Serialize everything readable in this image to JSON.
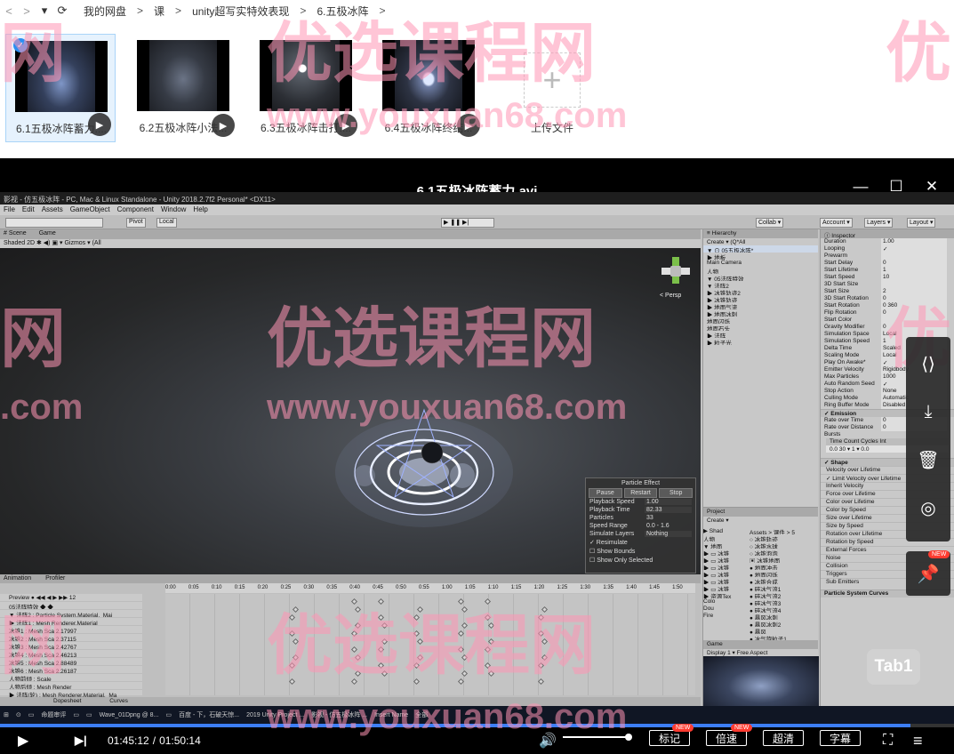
{
  "nav": {
    "back": "<",
    "forward": ">",
    "menu": "▾",
    "refresh": "⟳",
    "breadcrumbs": [
      "我的网盘",
      "课",
      "unity超写实特效表现",
      "6.五极冰阵"
    ],
    "sep": ">"
  },
  "files": [
    {
      "name": "6.1五极冰阵蓄力....",
      "selected": true
    },
    {
      "name": "6.2五极冰阵小法...",
      "selected": false
    },
    {
      "name": "6.3五极冰阵击打....",
      "selected": false
    },
    {
      "name": "6.4五极冰阵终结...",
      "selected": false
    }
  ],
  "upload_label": "上传文件",
  "check": "✓",
  "play_glyph": "▶",
  "player": {
    "title": "6.1五极冰阵蓄力.avi",
    "minimize": "—",
    "maximize": "☐",
    "close": "✕"
  },
  "unity": {
    "title": "影视 - 仿五极冰阵 - PC, Mac & Linux Standalone - Unity 2018.2.7f2 Personal* <DX11>",
    "menu": [
      "File",
      "Edit",
      "Assets",
      "GameObject",
      "Component",
      "Window",
      "Help"
    ],
    "toolbar": {
      "pivot": "Pivot",
      "local": "Local",
      "collab": "Collab ▾",
      "account": "Account ▾",
      "layers": "Layers ▾",
      "layout": "Layout ▾"
    },
    "scene_tabs": [
      "# Scene",
      "Game"
    ],
    "scene_ctrl": "Shaded     2D   ✱  ◀)  ▣  ▾     Gizmos ▾   (All",
    "persp": "< Persp",
    "particle_effect": {
      "header": "Particle Effect",
      "buttons": [
        "Pause",
        "Restart",
        "Stop"
      ],
      "rows": [
        {
          "k": "Playback Speed",
          "v": "1.00"
        },
        {
          "k": "Playback Time",
          "v": "82.33"
        },
        {
          "k": "Particles",
          "v": "33"
        },
        {
          "k": "Speed Range",
          "v": "0.0 - 1.6"
        },
        {
          "k": "Simulate Layers",
          "v": "Nothing"
        },
        {
          "k": "✓ Resimulate",
          "v": ""
        },
        {
          "k": "☐ Show Bounds",
          "v": ""
        },
        {
          "k": "☐ Show Only Selected",
          "v": ""
        }
      ]
    },
    "animation": {
      "tabs": [
        "Animation",
        "Profiler"
      ],
      "ruler": [
        "0:00",
        "0:05",
        "0:10",
        "0:15",
        "0:20",
        "0:25",
        "0:30",
        "0:35",
        "0:40",
        "0:45",
        "0:50",
        "0:55",
        "1:00",
        "1:05",
        "1:10",
        "1:15",
        "1:20",
        "1:25",
        "1:30",
        "1:35",
        "1:40",
        "1:45",
        "1:50"
      ],
      "props": [
        "Preview  ● ◀◀ ◀ ▶ ▶▶  12",
        "05法阵特效  ◆ ◆",
        "▼ 法阵2 : Particle System.Material._Mai",
        "  ▶ 法阵1 : Mesh Renderer.Material",
        "    冰锥1 : Mesh Sca 2.17997",
        "    冰锥2 : Mesh Sca 2.37115",
        "    冰锥3 : Mesh Sca 2.42767",
        "    冰锥4 : Mesh Sca 2.46213",
        "    冰锥5 : Mesh Sca 2.88489",
        "    冰锥6 : Mesh Sca 2.26187",
        "  人物前倾 : Scale",
        "  人物后倾 : Mesh Render",
        "  ▶ 法阵(轮) : Mesh Renderer.Material._Ma"
      ],
      "bottom": [
        "Dopesheet",
        "Curves"
      ]
    },
    "hierarchy": {
      "title": "≡ Hierarchy",
      "rows": [
        "Create ▾  (Q*All",
        "▼ ⊙ 05五极冰阵*",
        "    ▶ 地板",
        "       Main Camera",
        "       人物",
        "    ▼ 05法阵特效",
        "       ▼ 法阵2",
        "          ▶ 冰锥轨迹2",
        "          ▶ 冰锥轨迹",
        "          ▶ 地面气流",
        "          ▶ 地面冰刺",
        "             地面闪烁",
        "             地面石头",
        "          ▶ 法阵",
        "          ▶ 粒子光"
      ]
    },
    "project": {
      "title": "Project",
      "create": "Create ▾",
      "tree": [
        "▶ Shad",
        "   人物",
        "▼ 地面",
        "   ▶ ▭ 冰锥",
        "   ▶ ▭ 冰锥",
        "   ▶ ▭ 冰锥",
        "   ▶ ▭ 冰锥",
        "   ▶ ▭ 冰锥",
        "   ▶ ▭ 冰锥",
        "▶ 资源Tex",
        "   Colo",
        "   Dou",
        "   Fire"
      ],
      "path": "Assets > 课件 > 5",
      "list": [
        "  ○ 冰锥轨迹",
        "  ○ 冰锥水球",
        "  ○ 冰锥泡泡",
        "  ▣ 冰锥地面",
        "  ● 地面冲击",
        "  ● 地面闪烁",
        "  ● 冰锥合成",
        "  ● 碎冰气流1",
        "  ● 碎冰气流2",
        "  ● 碎冰气流3",
        "  ● 碎冰气流4",
        "  ● 暴风冰刺",
        "  ● 暴风冰刺2",
        "  ● 暴风",
        "  ● 冰气旋粒子1",
        "  ● 冰气旋粒子2",
        "  ● 冰气旋粒子3"
      ]
    },
    "game": {
      "title": "Game",
      "ctl": "Display 1   ▾  Free Aspect"
    },
    "inspector": {
      "title": "ⓘ Inspector",
      "rows": [
        {
          "k": "Duration",
          "v": "1.00"
        },
        {
          "k": "Looping",
          "v": "✓"
        },
        {
          "k": "Prewarm",
          "v": ""
        },
        {
          "k": "Start Delay",
          "v": "0"
        },
        {
          "k": "Start Lifetime",
          "v": "1"
        },
        {
          "k": "Start Speed",
          "v": "10"
        },
        {
          "k": "3D Start Size",
          "v": ""
        },
        {
          "k": "Start Size",
          "v": "2"
        },
        {
          "k": "3D Start Rotation",
          "v": "0"
        },
        {
          "k": "Start Rotation",
          "v": "0   360"
        },
        {
          "k": "Flip Rotation",
          "v": "0"
        },
        {
          "k": "Start Color",
          "v": ""
        },
        {
          "k": "Gravity Modifier",
          "v": "0"
        },
        {
          "k": "Simulation Space",
          "v": "Local"
        },
        {
          "k": "Simulation Speed",
          "v": "1"
        },
        {
          "k": "Delta Time",
          "v": "Scaled"
        },
        {
          "k": "Scaling Mode",
          "v": "Local"
        },
        {
          "k": "Play On Awake*",
          "v": "✓"
        },
        {
          "k": "Emitter Velocity",
          "v": "Rigidbody"
        },
        {
          "k": "Max Particles",
          "v": "1000"
        },
        {
          "k": "Auto Random Seed",
          "v": "✓"
        },
        {
          "k": "Stop Action",
          "v": "None"
        },
        {
          "k": "Culling Mode",
          "v": "Automatic"
        },
        {
          "k": "Ring Buffer Mode",
          "v": "Disabled"
        }
      ],
      "emission": "✓ Emission",
      "emission_rows": [
        {
          "k": "Rate over Time",
          "v": "0"
        },
        {
          "k": "Rate over Distance",
          "v": "0"
        }
      ],
      "bursts": "Bursts",
      "burst_header": "Time   Count   Cycles   Int",
      "burst_row": "0.0    30  ▾   1  ▾   0.0",
      "modules": [
        "✓ Shape",
        "   Velocity over Lifetime",
        "✓ Limit Velocity over Lifetime",
        "   Inherit Velocity",
        "   Force over Lifetime",
        "   Color over Lifetime",
        "   Color by Speed",
        "   Size over Lifetime",
        "   Size by Speed",
        "   Rotation over Lifetime",
        "   Rotation by Speed",
        "   External Forces",
        "   Noise",
        "   Collision",
        "   Triggers",
        "   Sub Emitters"
      ],
      "curves": "Particle System Curves"
    }
  },
  "side_buttons": [
    "share-icon",
    "download-icon",
    "delete-icon",
    "record-icon"
  ],
  "side_glyphs": [
    "⟨⟩",
    "⤓",
    "🗑",
    "◎"
  ],
  "pin_glyph": "📌",
  "new_badge": "NEW",
  "tab_hint": "Tab1",
  "taskbar": [
    "⊞",
    "⊙",
    "▭",
    "命题审评",
    "▭",
    "▭",
    "Wave_01Dpng @ 8...",
    "▭",
    "百度 - 下，石破天惊...",
    "2019 Unity Project ...",
    "影视 - 仿五极冰阵 ...",
    "Insert Name",
    "全部"
  ],
  "controls": {
    "time_current": "01:45:12",
    "time_total": "01:50:14",
    "time_sep": "/",
    "progress": 0.954,
    "volume": 1.0,
    "play": "▶",
    "next": "▶|",
    "volume_icon": "🔊",
    "mark": "标记",
    "speed": "倍速",
    "quality": "超清",
    "subtitle": "字幕",
    "fullscreen": "⛶",
    "list": "≡"
  },
  "watermarks": {
    "cn": "优选课程网",
    "url": "www.youxuan68.com",
    "cn_short": "网",
    "com": ".com",
    "cn_edge": "优"
  }
}
